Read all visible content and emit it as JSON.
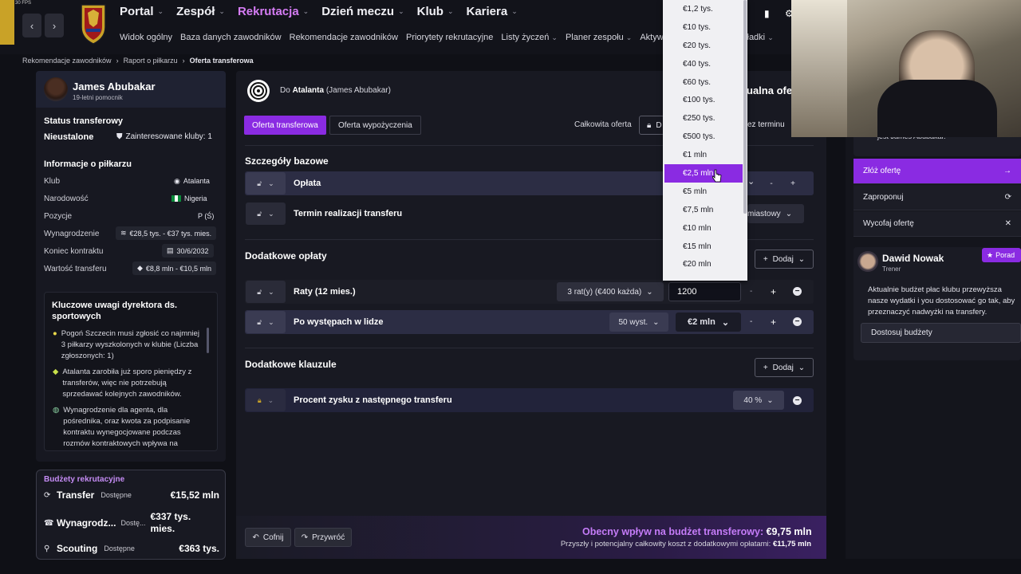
{
  "fps": "30 FPS",
  "nav": {
    "main": [
      "Portal",
      "Zespół",
      "Rekrutacja",
      "Dzień meczu",
      "Klub",
      "Kariera"
    ],
    "sub": [
      "Widok ogólny",
      "Baza danych zawodników",
      "Rekomendacje zawodników",
      "Priorytety rekrutacyjne",
      "Listy życzeń",
      "Planer zespołu",
      "Aktywność trans",
      "kładki"
    ]
  },
  "breadcrumb": [
    "Rekomendacje zawodników",
    "Raport o piłkarzu",
    "Oferta transferowa"
  ],
  "player": {
    "name": "James Abubakar",
    "sub": "19-letni pomocnik",
    "status_title": "Status transferowy",
    "status": "Nieustalone",
    "interested": "Zainteresowane kluby: 1",
    "info_title": "Informacje o piłkarzu",
    "info": [
      {
        "label": "Klub",
        "value": "Atalanta"
      },
      {
        "label": "Narodowość",
        "value": "Nigeria"
      },
      {
        "label": "Pozycje",
        "value": "P (Ś)"
      },
      {
        "label": "Wynagrodzenie",
        "value": "€28,5 tys. - €37 tys. mies."
      },
      {
        "label": "Koniec kontraktu",
        "value": "30/6/2032"
      },
      {
        "label": "Wartość transferu",
        "value": "€8,8 mln - €10,5 mln"
      }
    ],
    "notes_title": "Kluczowe uwagi dyrektora ds. sportowych",
    "notes": [
      "Pogoń Szczecin musi zgłosić co najmniej 3 piłkarzy wyszkolonych w klubie (Liczba zgłoszonych: 1)",
      "Atalanta zarobiła już sporo pieniędzy z transferów, więc nie potrzebują sprzedawać kolejnych zawodników.",
      "Wynagrodzenie dla agenta, dla pośrednika, oraz kwota za podpisanie kontraktu wynegocjowane podczas rozmów kontraktowych wpływa na"
    ]
  },
  "budgets": {
    "title": "Budżety rekrutacyjne",
    "rows": [
      {
        "name": "Transfer",
        "sub": "Dostępne",
        "value": "€15,52 mln"
      },
      {
        "name": "Wynagrodz...",
        "sub": "Dostę...",
        "value": "€337 tys. mies."
      },
      {
        "name": "Scouting",
        "sub": "Dostępne",
        "value": "€363 tys."
      }
    ]
  },
  "offer": {
    "to_prefix": "Do",
    "club": "Atalanta",
    "player_paren": "(James Abubakar)",
    "header_right": "ualna ofe",
    "tabs": [
      "Oferta transferowa",
      "Oferta wypożyczenia"
    ],
    "total_label": "Całkowita oferta",
    "total_partial": "D",
    "deadline_partial": "ez terminu",
    "base_title": "Szczegóły bazowe",
    "fee_label": "Opłata",
    "deadline_label": "Termin realizacji transferu",
    "deadline_value": "miastowy",
    "extra_fees_title": "Dodatkowe opłaty",
    "add_label": "Dodaj",
    "installments_label": "Raty (12 mies.)",
    "installments_select": "3 rat(y) (€400 każda)",
    "installments_value": "1200",
    "appearances_label": "Po występach w lidze",
    "appearances_select": "50 wyst.",
    "appearances_value": "€2 mln",
    "clauses_title": "Dodatkowe klauzule",
    "sellon_label": "Procent zysku z następnego transferu",
    "sellon_value": "40 %",
    "undo": "Cofnij",
    "redo": "Przywróć",
    "impact_label": "Obecny wpływ na budżet transferowy:",
    "impact_value": "€9,75 mln",
    "cost_label": "Przyszły i potencjalny całkowity koszt z dodatkowymi opłatami:",
    "cost_value": "€11,75 mln"
  },
  "dropdown": {
    "items": [
      "€1,2 tys.",
      "€10 tys.",
      "€20 tys.",
      "€40 tys.",
      "€60 tys.",
      "€100 tys.",
      "€250 tys.",
      "€500 tys.",
      "€1 mln",
      "€2,5 mln",
      "€5 mln",
      "€7,5 mln",
      "€10 mln",
      "€15 mln",
      "€20 mln"
    ],
    "selected_index": 9
  },
  "side": {
    "top_text": "jest James Abubakar.",
    "actions": [
      "Złóż ofertę",
      "Zaproponuj",
      "Wycofaj ofertę"
    ],
    "advisor_name": "Dawid Nowak",
    "advisor_role": "Trener",
    "advisor_badge": "Porad",
    "advisor_text": "Aktualnie budżet płac klubu przewyższa nasze wydatki i you dostosować go tak, aby przeznaczyć nadwyżki na transfery.",
    "advisor_button": "Dostosuj budżety"
  },
  "colors": {
    "accent": "#8a2be2",
    "nav_active": "#d57cf4",
    "budget_title": "#c58cf5",
    "impact": "#c57cf8"
  }
}
